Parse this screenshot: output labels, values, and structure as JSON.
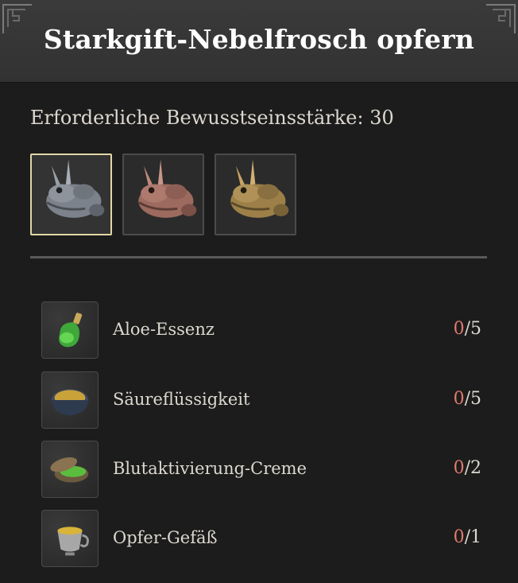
{
  "header": {
    "title": "Starkgift-Nebelfrosch opfern"
  },
  "requirement": {
    "text": "Erforderliche Bewusstseinsstärke: 30"
  },
  "variants": [
    {
      "icon": "frog-grey-icon",
      "color": "#8a9099",
      "selected": true
    },
    {
      "icon": "frog-pink-icon",
      "color": "#a87468",
      "selected": false
    },
    {
      "icon": "frog-gold-icon",
      "color": "#a88a52",
      "selected": false
    }
  ],
  "materials": [
    {
      "name": "Aloe-Essenz",
      "have": "0",
      "need": "/5",
      "icon": "aloe-essence-bottle-icon"
    },
    {
      "name": "Säureflüssigkeit",
      "have": "0",
      "need": "/5",
      "icon": "acid-liquid-bowl-icon"
    },
    {
      "name": "Blutaktivierung-Creme",
      "have": "0",
      "need": "/2",
      "icon": "blood-activation-cream-icon"
    },
    {
      "name": "Opfer-Gefäß",
      "have": "0",
      "need": "/1",
      "icon": "sacrificial-vessel-cup-icon"
    }
  ],
  "colors": {
    "selected_border": "#e2d7a6",
    "missing_count": "#e07a6e",
    "background": "#1c1c1c"
  }
}
